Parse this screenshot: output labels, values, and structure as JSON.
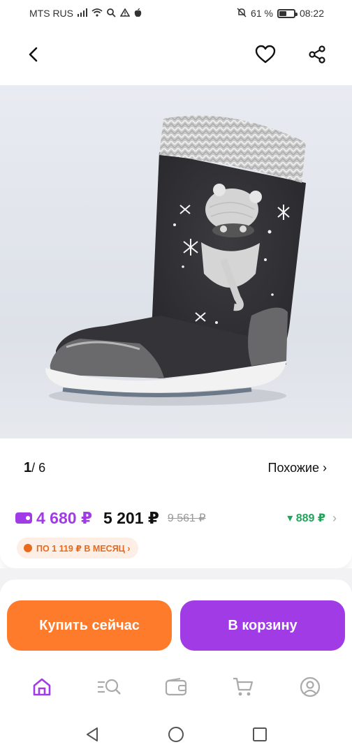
{
  "status_bar": {
    "carrier": "MTS RUS",
    "battery_percent": "61 %",
    "battery_level": 0.61,
    "time": "08:22",
    "icons": [
      "signal-icon",
      "wifi-icon",
      "search-icon",
      "warning-icon",
      "apple-icon",
      "mute-icon",
      "battery-icon"
    ]
  },
  "header": {
    "icons": [
      "back-arrow-icon",
      "heart-icon",
      "share-icon"
    ]
  },
  "gallery": {
    "current": "1",
    "total": "6",
    "separator": "/",
    "similar_label": "Похожие ›"
  },
  "price": {
    "card_price": "4 680 ₽",
    "price": "5 201 ₽",
    "old_price": "9 561 ₽",
    "discount": "▾ 889 ₽",
    "installment": "ПО 1 119 ₽ В МЕСЯЦ ›"
  },
  "actions": {
    "buy_now": "Купить сейчас",
    "add_to_cart": "В корзину"
  },
  "tabs": [
    "home-icon",
    "catalog-search-icon",
    "wallet-icon",
    "cart-icon",
    "profile-icon"
  ],
  "system_nav": [
    "back-triangle-icon",
    "home-circle-icon",
    "recents-square-icon"
  ],
  "colors": {
    "accent_purple": "#a13be6",
    "accent_orange": "#ff7b2c",
    "discount_green": "#22a55a"
  }
}
